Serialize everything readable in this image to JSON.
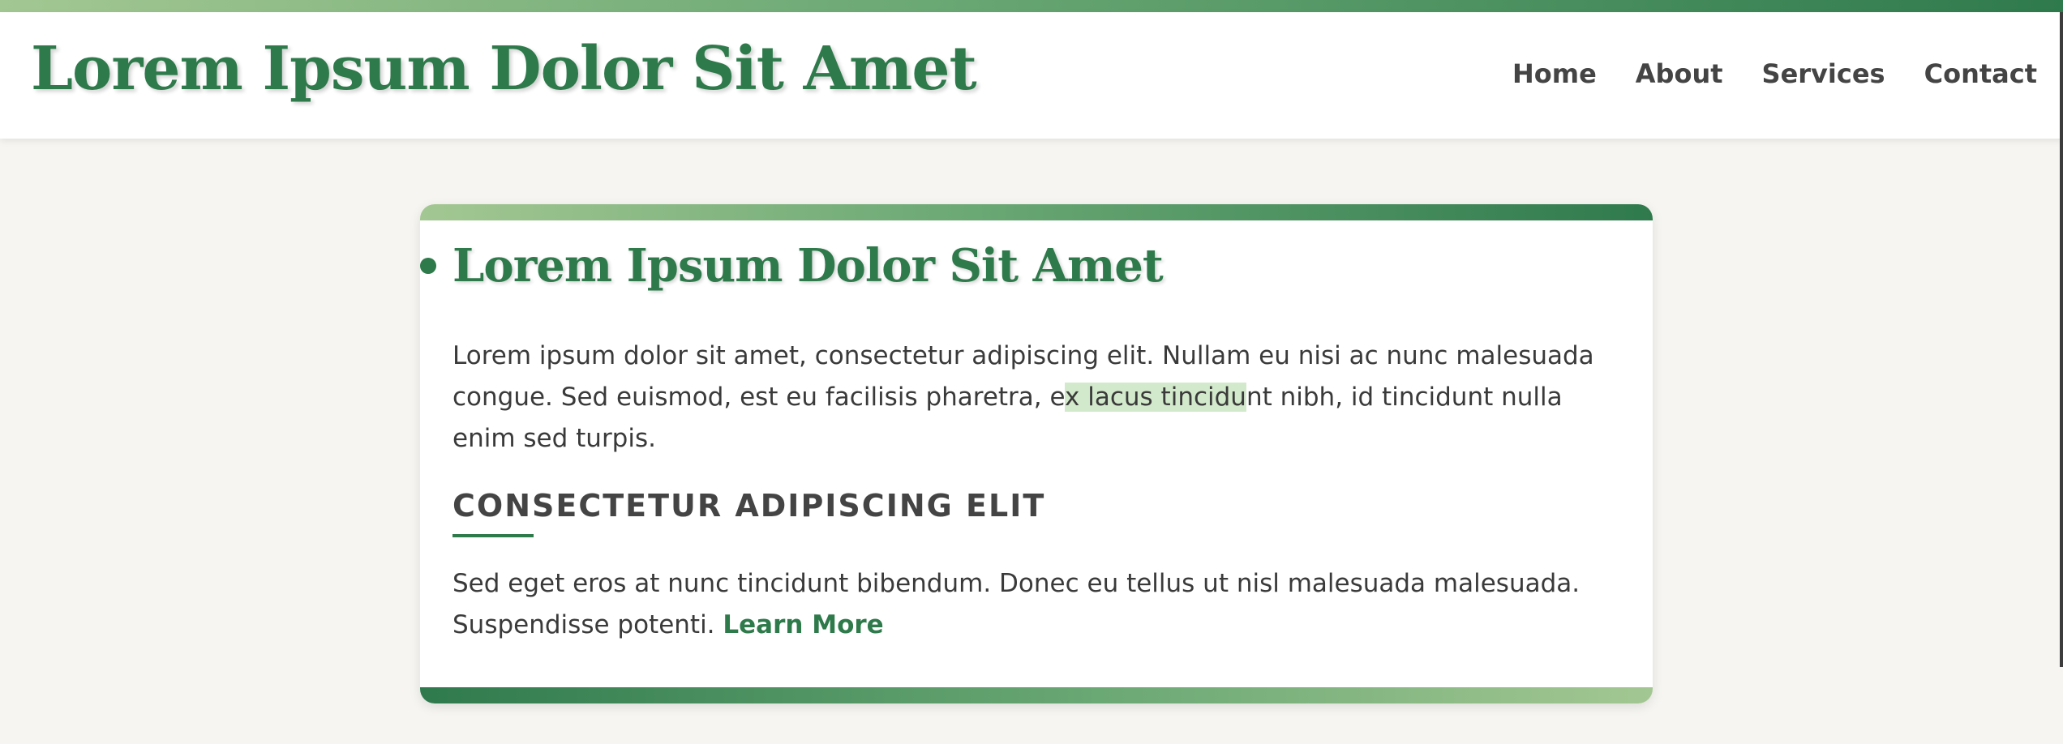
{
  "header": {
    "site_title": "Lorem Ipsum Dolor Sit Amet",
    "nav": [
      {
        "label": "Home"
      },
      {
        "label": "About"
      },
      {
        "label": "Services"
      },
      {
        "label": "Contact"
      }
    ]
  },
  "card": {
    "heading": "Lorem Ipsum Dolor Sit Amet",
    "paragraph1": {
      "before": "Lorem ipsum dolor sit amet, consectetur adipiscing elit. Nullam eu nisi ac nunc malesuada congue. Sed euismod, est eu facilisis pharetra, e",
      "highlight": "x lacus tincidu",
      "after": "nt nibh, id tincidunt nulla enim sed turpis."
    },
    "subheading": "CONSECTETUR ADIPISCING ELIT",
    "paragraph2": {
      "text": "Sed eget eros at nunc tincidunt bibendum. Donec eu tellus ut nisl malesuada malesuada. Suspendisse potenti. ",
      "link_label": "Learn More"
    }
  },
  "colors": {
    "accent": "#2e7a4b",
    "gradient_light": "#a3c792",
    "highlight_bg": "#d3e9cc",
    "page_bg": "#f6f5f1"
  }
}
